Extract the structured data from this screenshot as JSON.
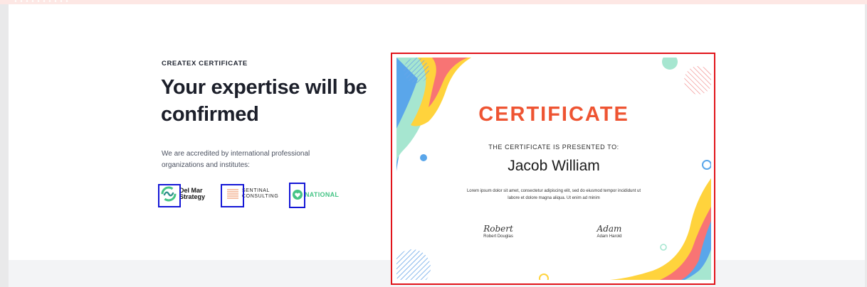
{
  "section": {
    "eyebrow": "CREATEX CERTIFICATE",
    "headline": "Your expertise will be confirmed",
    "description": "We are accredited by international professional organizations and institutes:"
  },
  "partners": [
    {
      "name": "Del Mar Strategy",
      "icon": "swirl-icon"
    },
    {
      "name": "SENTINAL CONSULTING",
      "icon": "stripes-icon"
    },
    {
      "name": "NATIONAL",
      "icon": "heart-icon"
    }
  ],
  "certificate": {
    "title": "CERTIFICATE",
    "presented": "THE CERTIFICATE IS PRESENTED TO:",
    "recipient": "Jacob William",
    "body": "Lorem ipsum dolor sit amet, consectetur adipiscing elit, sed do eiusmod tempor incididunt ut labore et dolore magna aliqua. Ut enim ad minim",
    "signatures": [
      {
        "script": "Robert",
        "name": "Robert Douglas"
      },
      {
        "script": "Adam",
        "name": "Adam Harold"
      }
    ]
  },
  "colors": {
    "accent": "#ee5432",
    "highlight_box": "#1417d6",
    "frame": "#e1141a",
    "green": "#45c486"
  }
}
